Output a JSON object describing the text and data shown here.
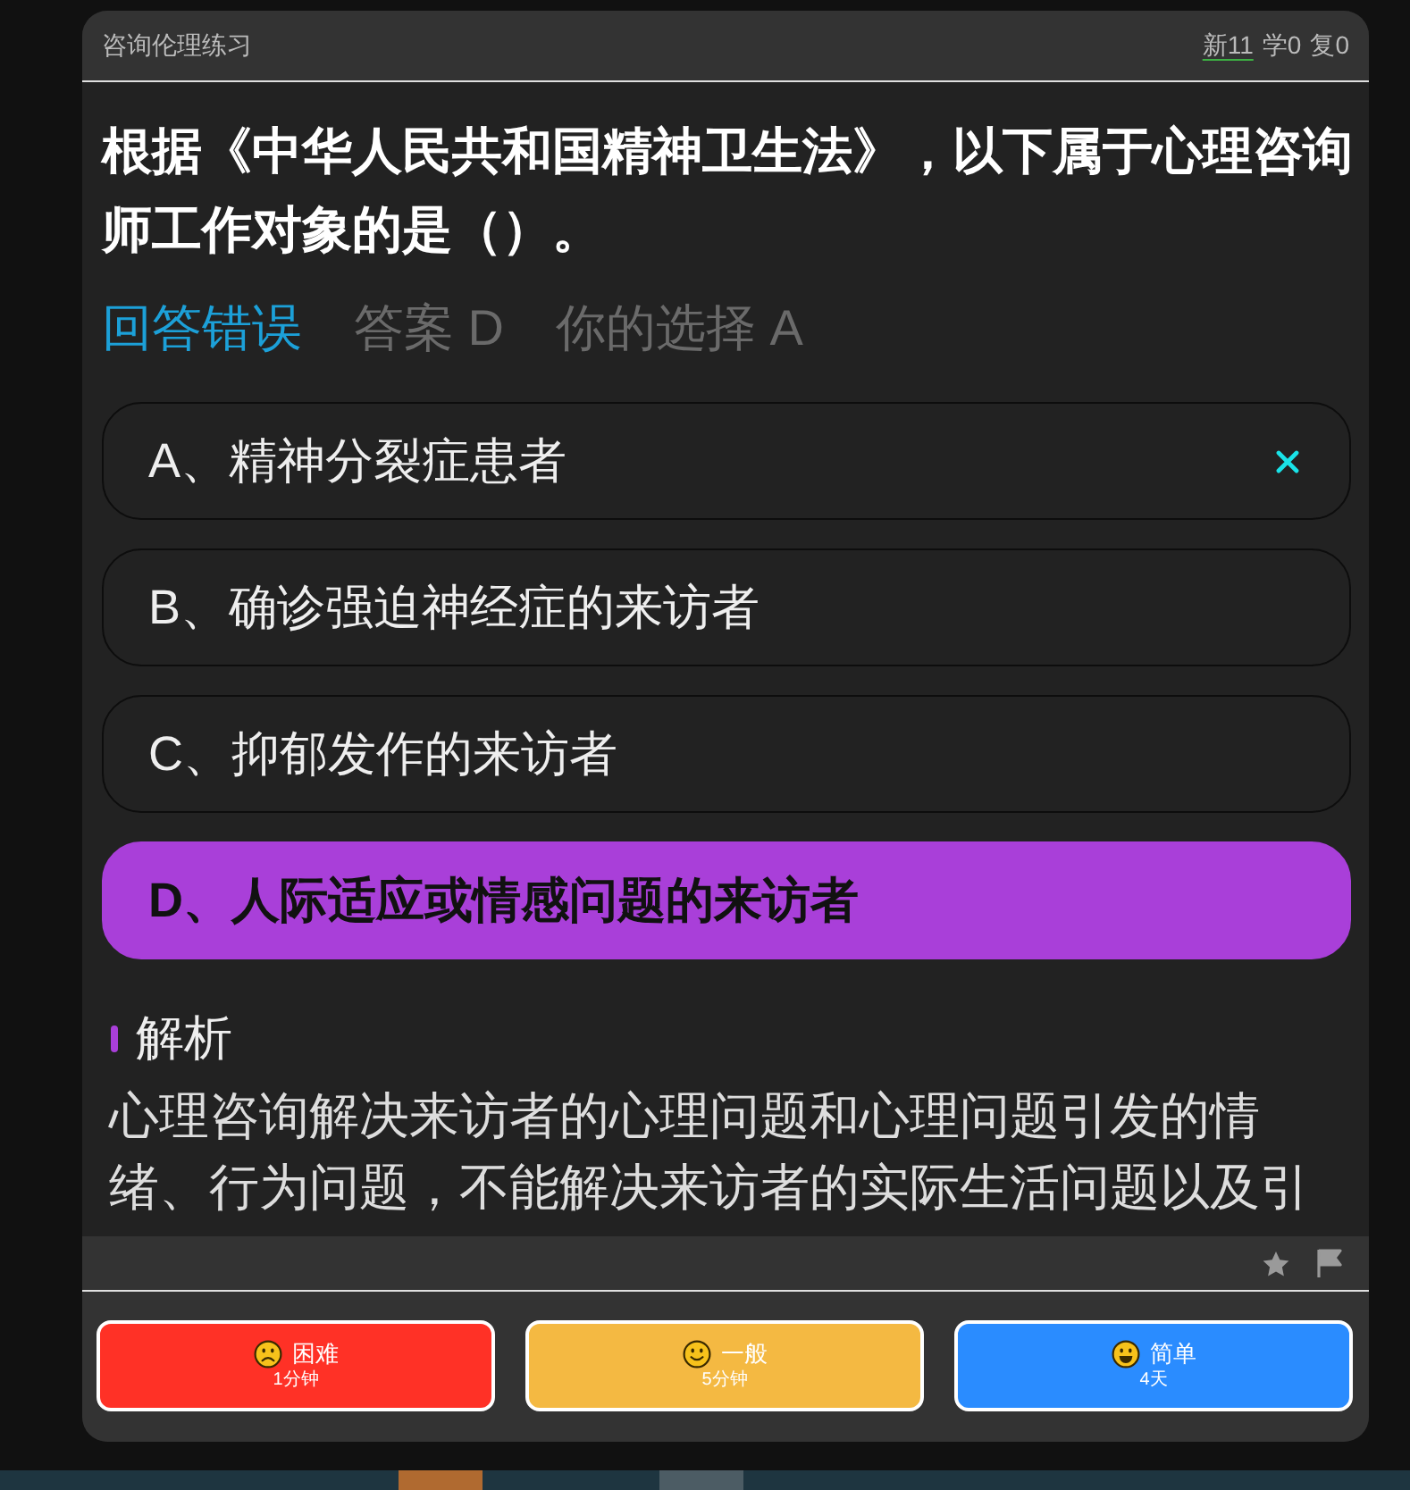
{
  "header": {
    "title": "咨询伦理练习",
    "stats": [
      {
        "text": "新11",
        "selected": true
      },
      {
        "text": "学0",
        "selected": false
      },
      {
        "text": "复0",
        "selected": false
      }
    ]
  },
  "question": "根据《中华人民共和国精神卫生法》，以下属于心理咨询师工作对象的是（）。",
  "result": {
    "text": "回答错误",
    "correct": false,
    "answer": "答案 D",
    "choice": "你的选择 A"
  },
  "options": [
    {
      "text": "A、精神分裂症患者",
      "kind": "wrong"
    },
    {
      "text": "B、确诊强迫神经症的来访者",
      "kind": "plain"
    },
    {
      "text": "C、抑郁发作的来访者",
      "kind": "plain"
    },
    {
      "text": "D、人际适应或情感问题的来访者",
      "kind": "right"
    }
  ],
  "explanation": {
    "heading": "解析",
    "text": "心理咨询解决来访者的心理问题和心理问题引发的情绪、行为问题，不能解决来访者的实际生活问题以及引"
  },
  "ratings": [
    {
      "kind": "hard",
      "label": "困难",
      "interval": "1分钟",
      "color": "#ff3126"
    },
    {
      "kind": "medium",
      "label": "一般",
      "interval": "5分钟",
      "color": "#f4b942"
    },
    {
      "kind": "easy",
      "label": "简单",
      "interval": "4天",
      "color": "#2a8cff"
    }
  ]
}
